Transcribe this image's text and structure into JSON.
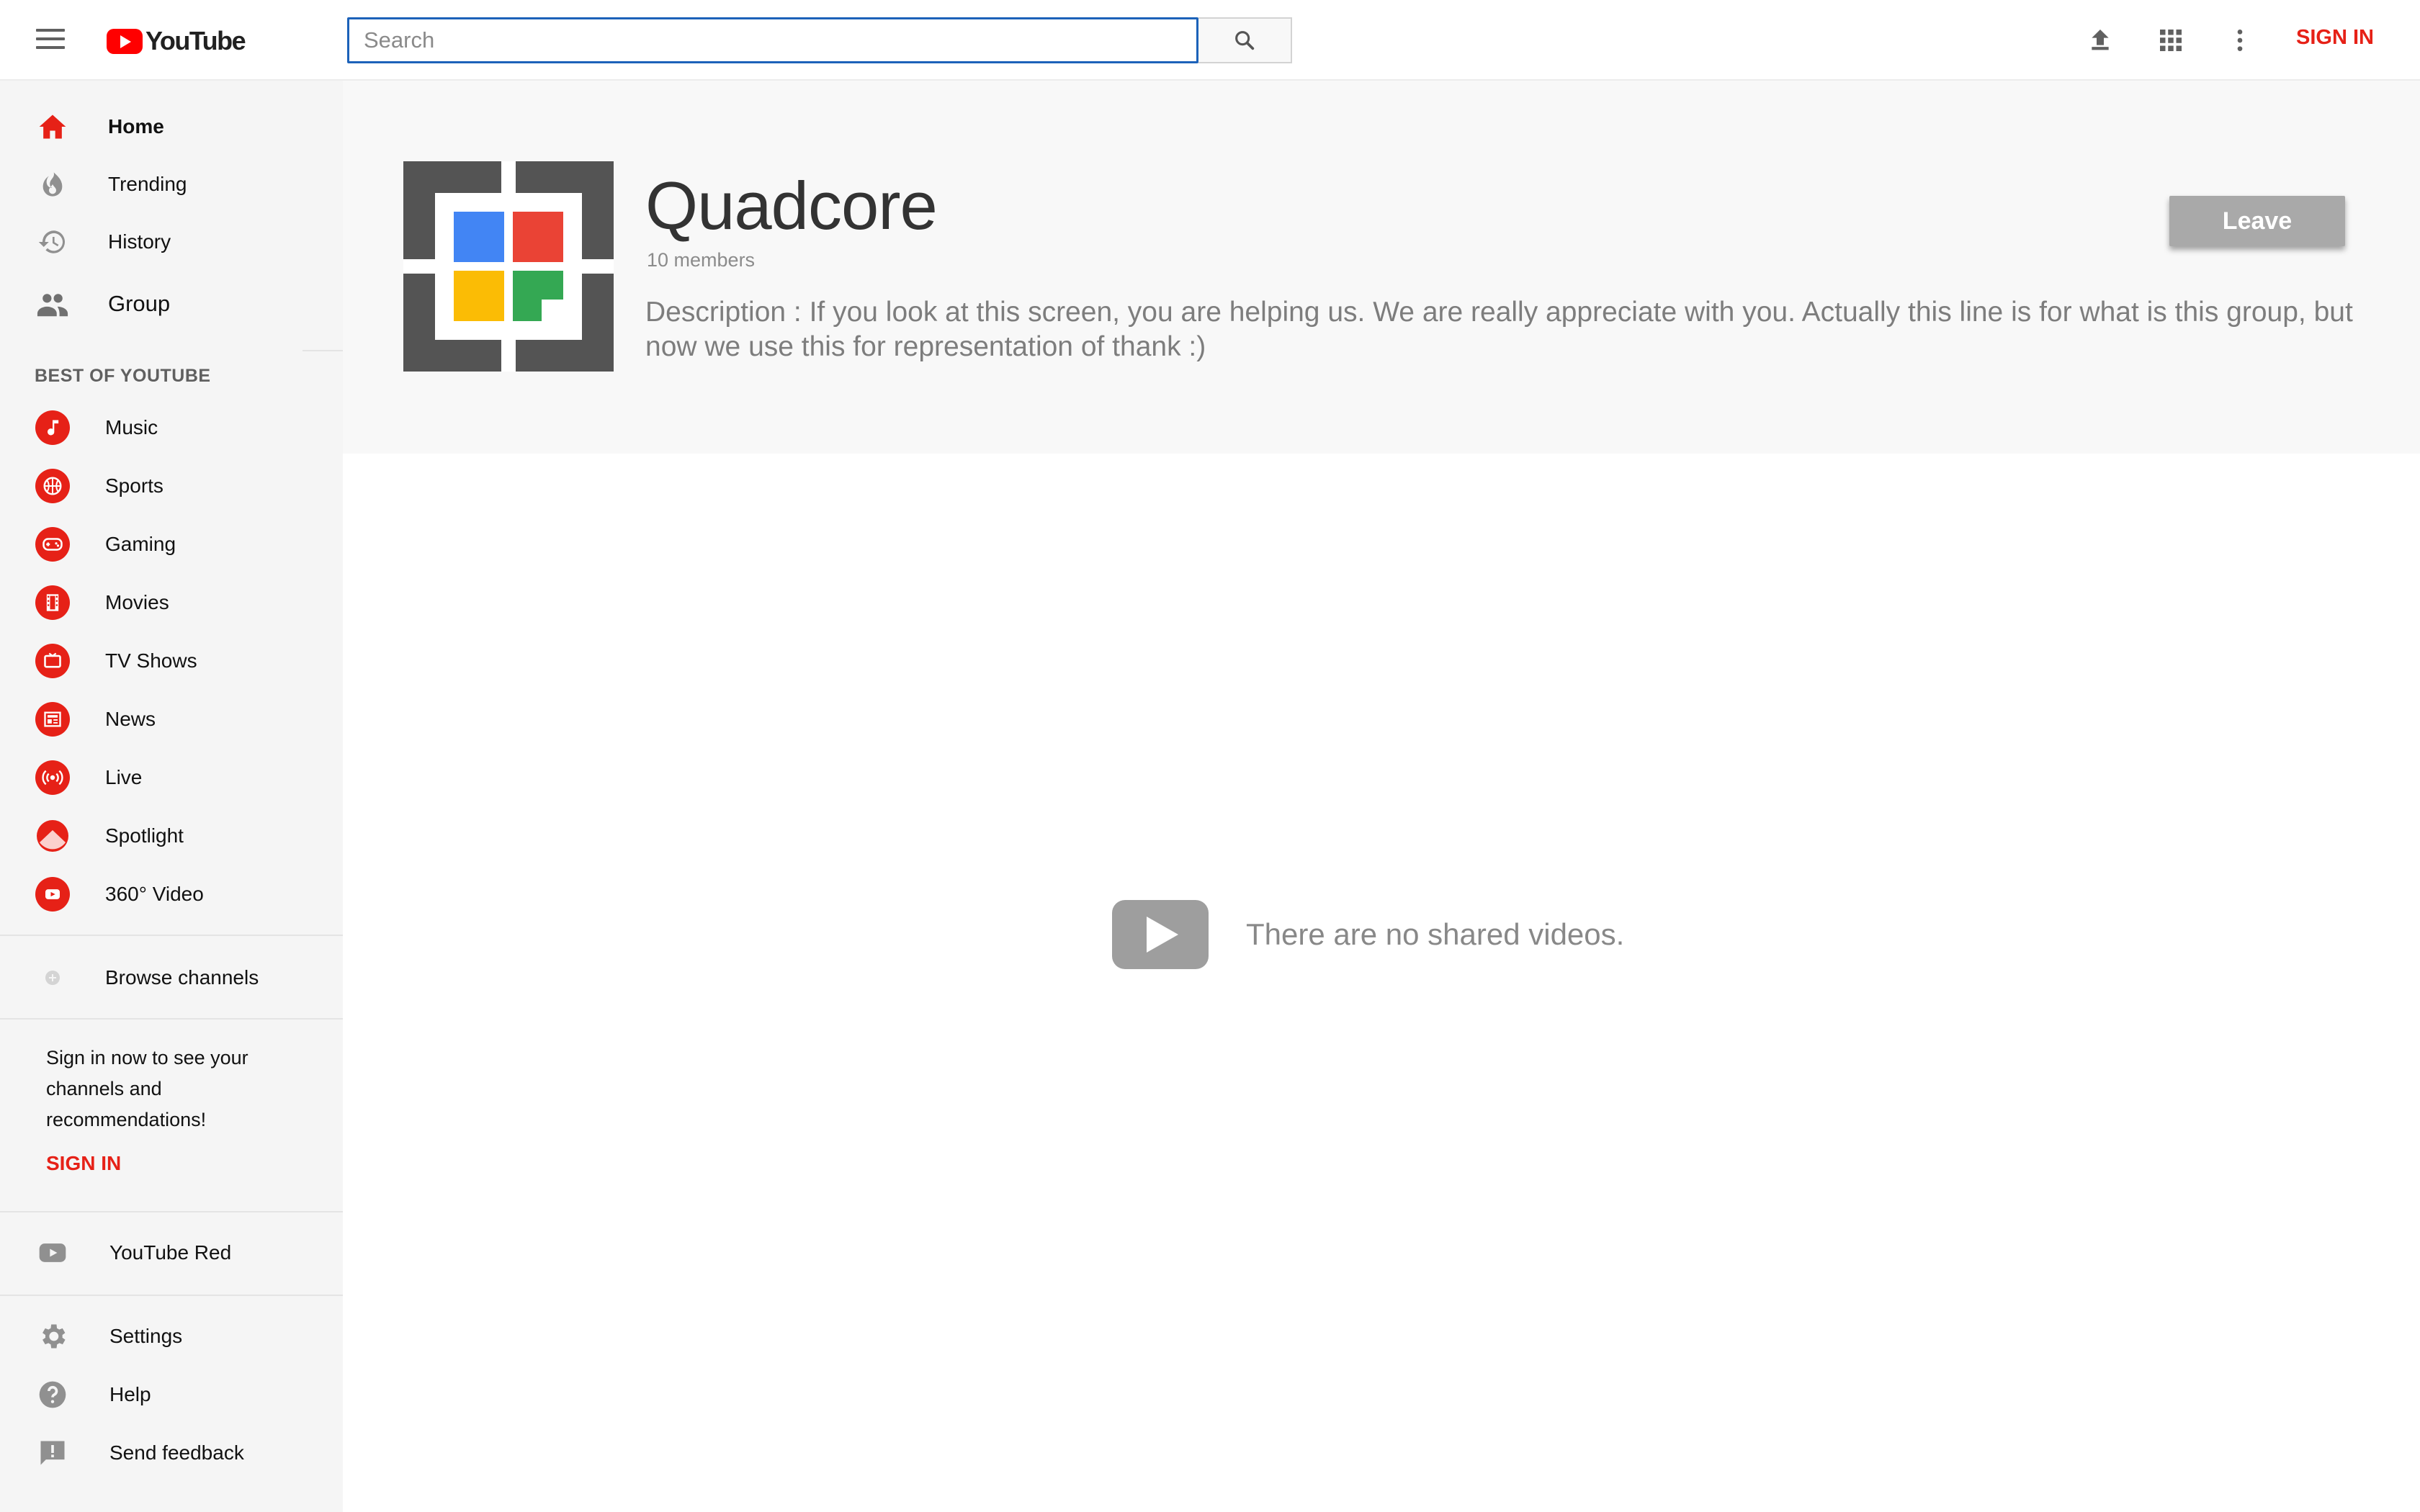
{
  "topbar": {
    "logo_text": "YouTube",
    "search_placeholder": "Search",
    "sign_in": "SIGN IN",
    "icons": [
      "menu-icon",
      "search-icon",
      "upload-icon",
      "apps-grid-icon",
      "more-vert-icon"
    ]
  },
  "sidebar": {
    "main": [
      {
        "label": "Home",
        "icon": "home-icon"
      },
      {
        "label": "Trending",
        "icon": "flame-icon"
      },
      {
        "label": "History",
        "icon": "history-icon"
      },
      {
        "label": "Group",
        "icon": "group-icon"
      }
    ],
    "best_heading": "BEST OF YOUTUBE",
    "best": [
      {
        "label": "Music",
        "icon": "music-note-icon"
      },
      {
        "label": "Sports",
        "icon": "basketball-icon"
      },
      {
        "label": "Gaming",
        "icon": "gamepad-icon"
      },
      {
        "label": "Movies",
        "icon": "film-strip-icon"
      },
      {
        "label": "TV Shows",
        "icon": "tv-icon"
      },
      {
        "label": "News",
        "icon": "newspaper-icon"
      },
      {
        "label": "Live",
        "icon": "live-broadcast-icon"
      },
      {
        "label": "Spotlight",
        "icon": "spotlight-icon"
      },
      {
        "label": "360° Video",
        "icon": "video-360-icon"
      }
    ],
    "browse_channels": "Browse channels",
    "signin_promo": "Sign in now to see your channels and recommendations!",
    "signin_link": "SIGN IN",
    "youtube_red": "YouTube Red",
    "footer": [
      {
        "label": "Settings",
        "icon": "gear-icon"
      },
      {
        "label": "Help",
        "icon": "help-icon"
      },
      {
        "label": "Send feedback",
        "icon": "feedback-icon"
      }
    ],
    "accent_color": "#e62117"
  },
  "group": {
    "name": "Quadcore",
    "members": "10 members",
    "description": "Description : If you look at this screen, you are helping us. We are really appreciate with you. Actually this line is for what is this group, but now we use this for representation of thank :)",
    "leave_label": "Leave",
    "logo_colors": [
      "#4285f4",
      "#ea4335",
      "#fbbc05",
      "#34a853"
    ]
  },
  "content": {
    "empty_message": "There are no shared videos."
  }
}
